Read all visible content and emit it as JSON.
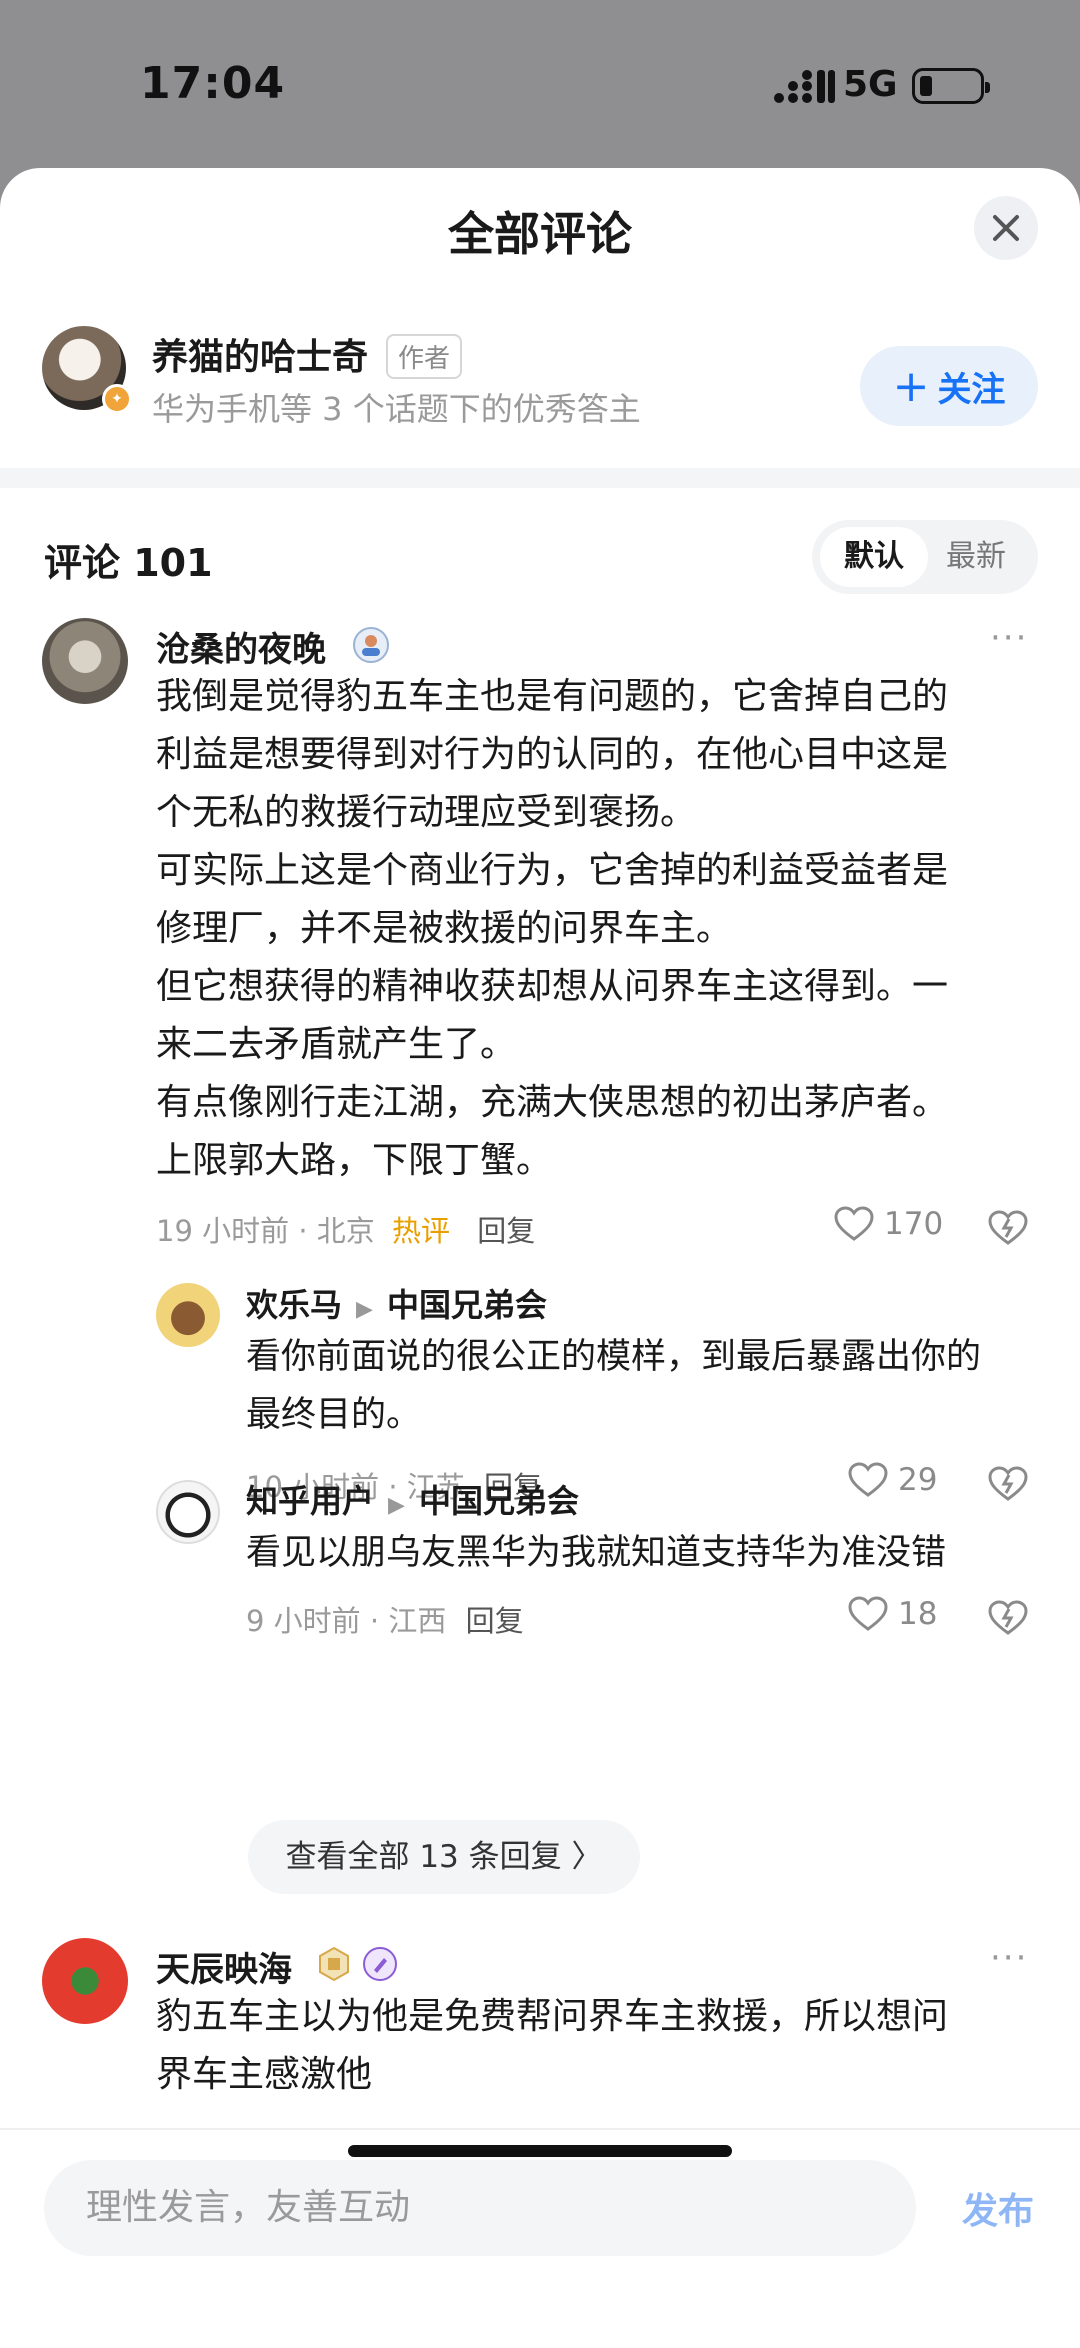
{
  "status_bar": {
    "time": "17:04",
    "network": "5G"
  },
  "sheet": {
    "title": "全部评论"
  },
  "author": {
    "name": "养猫的哈士奇",
    "tag": "作者",
    "description": "华为手机等 3 个话题下的优秀答主",
    "follow_label": "关注"
  },
  "comments_header": {
    "count_label": "评论 101",
    "sort_default": "默认",
    "sort_latest": "最新"
  },
  "comments": [
    {
      "user": "沧桑的夜晚",
      "lines": [
        "我倒是觉得豹五车主也是有问题的，它舍掉自己的",
        "利益是想要得到对行为的认同的，在他心目中这是",
        "个无私的救援行动理应受到褒扬。",
        "可实际上这是个商业行为，它舍掉的利益受益者是",
        "修理厂，并不是被救援的问界车主。",
        "但它想获得的精神收获却想从问界车主这得到。一",
        "来二去矛盾就产生了。",
        "有点像刚行走江湖，充满大侠思想的初出茅庐者。",
        "上限郭大路，下限丁蟹。"
      ],
      "time": "19 小时前",
      "location": "北京",
      "hot": "热评",
      "reply": "回复",
      "likes": "170"
    },
    {
      "user": "天辰映海",
      "lines": [
        "豹五车主以为他是免费帮问界车主救援，所以想问",
        "界车主感激他"
      ]
    }
  ],
  "replies": [
    {
      "user": "欢乐马",
      "reply_to": "中国兄弟会",
      "lines": [
        "看你前面说的很公正的模样，到最后暴露出你的",
        "最终目的。"
      ],
      "time": "10 小时前",
      "location": "江苏",
      "reply": "回复",
      "likes": "29"
    },
    {
      "user": "知乎用户",
      "reply_to": "中国兄弟会",
      "lines": [
        "看见以朋乌友黑华为我就知道支持华为准没错"
      ],
      "time": "9 小时前",
      "location": "江西",
      "reply": "回复",
      "likes": "18"
    }
  ],
  "view_all_replies": "查看全部 13 条回复 〉",
  "composer": {
    "placeholder": "理性发言，友善互动",
    "publish_label": "发布"
  },
  "colors": {
    "accent": "#1772f6",
    "hot": "#e8a000",
    "muted": "#9a9a9a"
  }
}
